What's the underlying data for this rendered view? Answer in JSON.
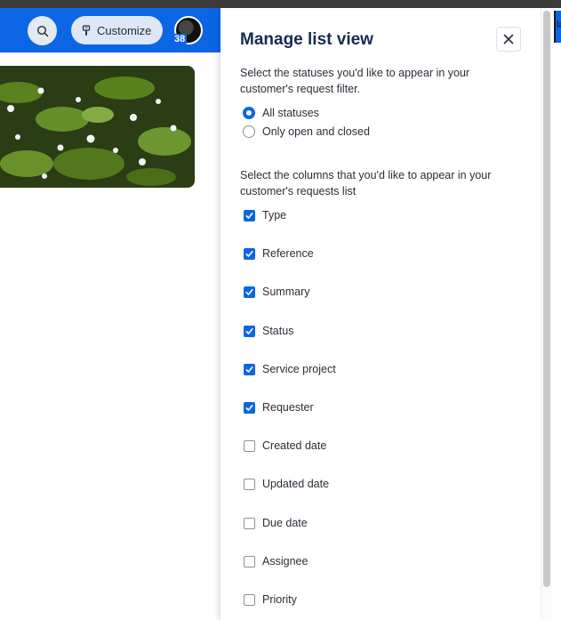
{
  "header": {
    "customize_label": "Customize",
    "avatar_badge": "38"
  },
  "right_edge": {
    "text": "la"
  },
  "panel": {
    "title": "Manage list view",
    "status_prompt": "Select the statuses you'd like to appear in your customer's request filter.",
    "status_options": [
      {
        "label": "All statuses",
        "selected": true
      },
      {
        "label": "Only open and closed",
        "selected": false
      }
    ],
    "columns_prompt": "Select the columns that you'd like to appear in your customer's requests list",
    "columns": [
      {
        "label": "Type",
        "checked": true
      },
      {
        "label": "Reference",
        "checked": true
      },
      {
        "label": "Summary",
        "checked": true
      },
      {
        "label": "Status",
        "checked": true
      },
      {
        "label": "Service project",
        "checked": true
      },
      {
        "label": "Requester",
        "checked": true
      },
      {
        "label": "Created date",
        "checked": false
      },
      {
        "label": "Updated date",
        "checked": false
      },
      {
        "label": "Due date",
        "checked": false
      },
      {
        "label": "Assignee",
        "checked": false
      },
      {
        "label": "Priority",
        "checked": false
      }
    ]
  },
  "colors": {
    "brand_blue": "#0c66e4",
    "text": "#172b4d"
  },
  "icons": {
    "search": "search-icon",
    "customize": "paintbrush-icon",
    "close": "close-icon",
    "check": "checkmark-icon"
  }
}
